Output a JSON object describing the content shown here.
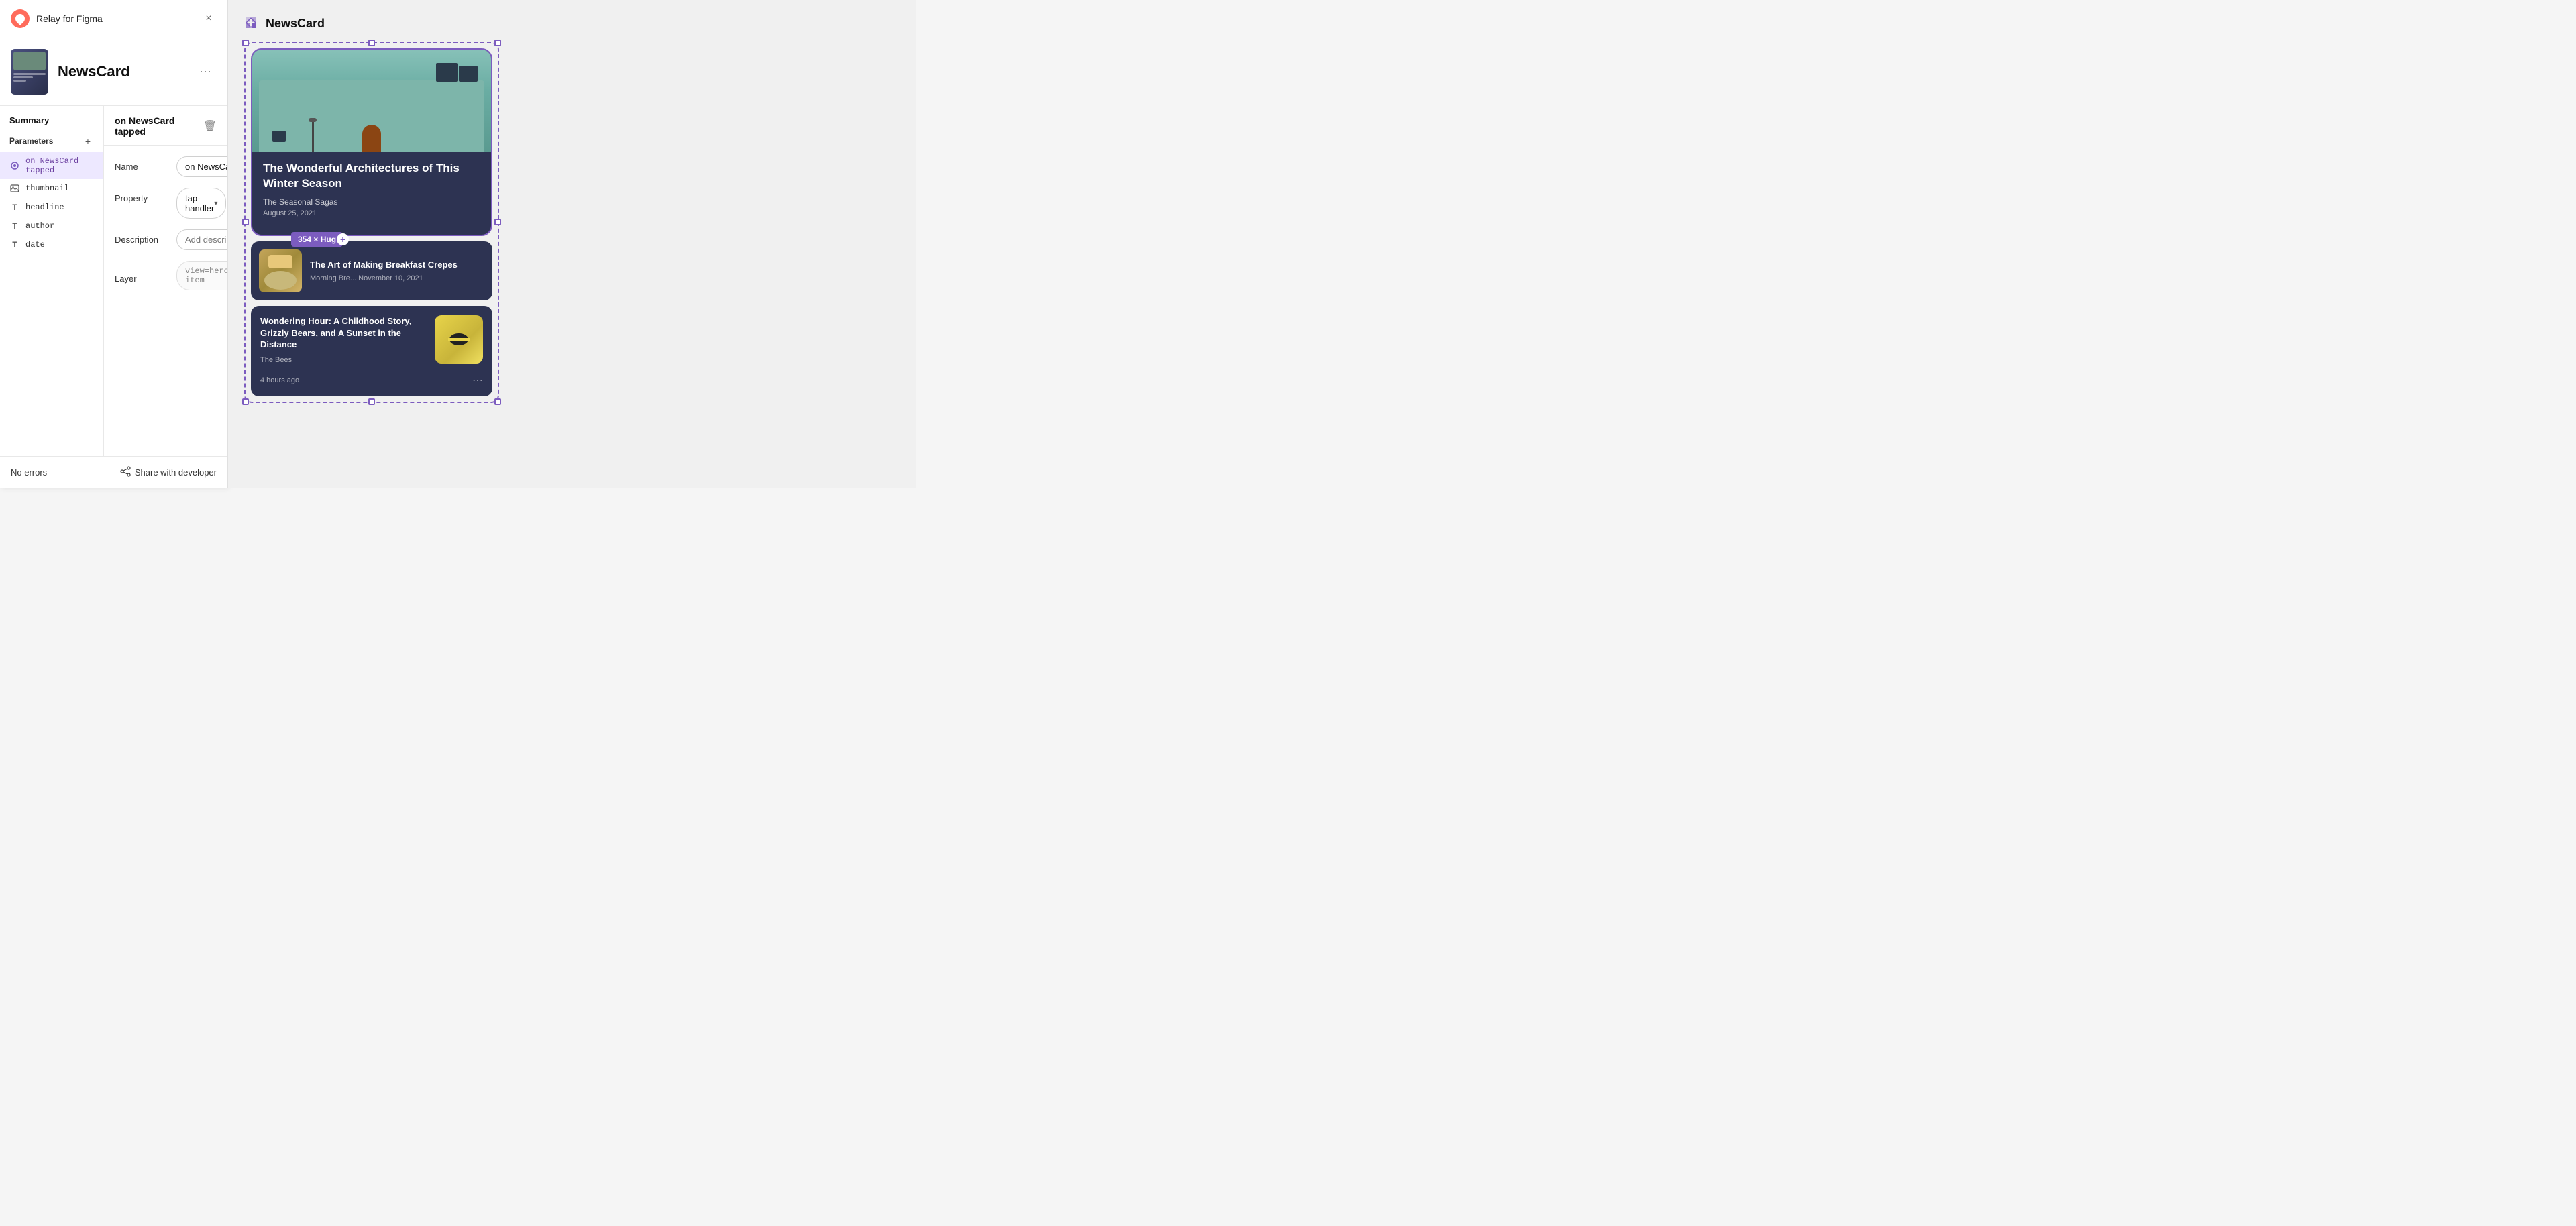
{
  "app": {
    "title": "Relay for Figma",
    "close_label": "×"
  },
  "component": {
    "name": "NewsCard",
    "more_label": "⋯"
  },
  "summary": {
    "title": "Summary",
    "parameters_label": "Parameters",
    "add_label": "+"
  },
  "params": [
    {
      "id": "interaction",
      "icon_type": "interaction",
      "icon_symbol": "⚡",
      "label": "on NewsCard tapped",
      "active": true
    },
    {
      "id": "thumbnail",
      "icon_type": "image",
      "icon_symbol": "⊡",
      "label": "thumbnail",
      "active": false
    },
    {
      "id": "headline",
      "icon_type": "text",
      "icon_symbol": "T",
      "label": "headline",
      "active": false
    },
    {
      "id": "author",
      "icon_type": "text",
      "icon_symbol": "T",
      "label": "author",
      "active": false
    },
    {
      "id": "date",
      "icon_type": "text",
      "icon_symbol": "T",
      "label": "date",
      "active": false
    }
  ],
  "detail": {
    "title": "on NewsCard tapped",
    "delete_label": "🗑",
    "name_label": "Name",
    "name_value": "on NewsCard tapped",
    "property_label": "Property",
    "property_value": "tap-handler",
    "description_label": "Description",
    "description_placeholder": "Add description",
    "layer_label": "Layer",
    "layer_value": "view=hero-item"
  },
  "footer": {
    "status": "No errors",
    "share_label": "Share with developer"
  },
  "canvas": {
    "component_label": "NewsCard",
    "hero_card": {
      "title": "The Wonderful Architectures of This Winter Season",
      "author": "The Seasonal Sagas",
      "date": "August 25, 2021"
    },
    "small_card": {
      "title": "The Art of Making Breakfast Crepes",
      "meta": "Morning Bre...   November 10, 2021",
      "dimension": "354 × Hug"
    },
    "third_card": {
      "title": "Wondering Hour: A Childhood Story, Grizzly Bears, and A Sunset in the Distance",
      "author": "The Bees",
      "time": "4 hours ago"
    }
  }
}
